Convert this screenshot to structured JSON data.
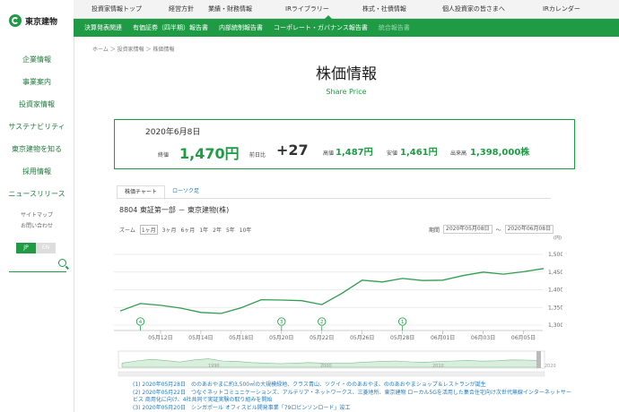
{
  "brand": {
    "name": "東京建物"
  },
  "sidebar": {
    "items": [
      {
        "label": "企業情報"
      },
      {
        "label": "事業案内"
      },
      {
        "label": "投資家情報"
      },
      {
        "label": "サステナビリティ"
      },
      {
        "label": "東京建物を知る"
      },
      {
        "label": "採用情報"
      },
      {
        "label": "ニュースリリース"
      }
    ],
    "small": [
      "サイトマップ",
      "お問い合わせ"
    ],
    "lang": {
      "jp": "JP",
      "en": "EN"
    }
  },
  "topnav": [
    "投資家情報トップ",
    "経営方針",
    "業績・財務情報",
    "IRライブラリー",
    "株式・社債情報",
    "個人投資家の皆さまへ",
    "IRカレンダー"
  ],
  "subnav": [
    {
      "label": "決算発表関連",
      "dim": false
    },
    {
      "label": "有価証券（四半期）報告書",
      "dim": false
    },
    {
      "label": "内部統制報告書",
      "dim": false
    },
    {
      "label": "コーポレート・ガバナンス報告書",
      "dim": false
    },
    {
      "label": "統合報告書",
      "dim": true
    }
  ],
  "breadcrumb": "ホーム ＞ 投資家情報 ＞ 株価情報",
  "page": {
    "title": "株価情報",
    "subtitle": "Share Price"
  },
  "price": {
    "date": "2020年6月8日",
    "end_label": "終値",
    "end_value": "1,470円",
    "change_label": "前日比",
    "change_value": "+27",
    "high_label": "高値",
    "high_value": "1,487円",
    "low_label": "安値",
    "low_value": "1,461円",
    "volume_label": "出来高",
    "volume_value": "1,398,000株"
  },
  "tabs": [
    {
      "label": "株価チャート",
      "active": true
    },
    {
      "label": "ローソク足",
      "active": false
    }
  ],
  "stock_name": "8804 東証第一部 － 東京建物(株)",
  "zoom": {
    "label": "ズーム",
    "options": [
      "1ヶ月",
      "3ヶ月",
      "6ヶ月",
      "1年",
      "2年",
      "5年",
      "10年"
    ],
    "selected": "1ヶ月"
  },
  "range": {
    "label": "期間",
    "from": "2020年05月08日",
    "sep": "～",
    "to": "2020年06月08日"
  },
  "chart_data": {
    "type": "line",
    "unit": "(円)",
    "yticks": [
      1300,
      1350,
      1400,
      1450,
      1500
    ],
    "ytick_labels": [
      "1,300",
      "1,350",
      "1,400",
      "1,450",
      "1,500"
    ],
    "ylim": [
      1300,
      1500
    ],
    "xticks": [
      "05月12日",
      "05月14日",
      "05月18日",
      "05月20日",
      "05月22日",
      "05月26日",
      "05月28日",
      "06月01日",
      "06月03日",
      "06月05日"
    ],
    "xtick_index": [
      2,
      4,
      6,
      8,
      10,
      12,
      14,
      16,
      18,
      20
    ],
    "values": [
      1340,
      1361,
      1356,
      1348,
      1336,
      1333,
      1349,
      1372,
      1371,
      1369,
      1358,
      1390,
      1427,
      1422,
      1432,
      1426,
      1427,
      1440,
      1450,
      1444,
      1451,
      1460
    ],
    "events": [
      {
        "label": "4",
        "index": 1
      },
      {
        "label": "3",
        "index": 8
      },
      {
        "label": "2",
        "index": 10
      },
      {
        "label": "1",
        "index": 14
      }
    ],
    "navigator": {
      "labels": [
        "1990",
        "2000",
        "2010",
        "2020"
      ],
      "values": [
        0.3,
        0.5,
        0.65,
        0.55,
        0.4,
        0.6,
        0.7,
        0.5,
        0.45,
        0.35,
        0.3,
        0.25,
        0.3,
        0.35,
        0.3,
        0.28,
        0.32,
        0.4,
        0.45,
        0.5,
        0.42,
        0.38,
        0.44,
        0.5,
        0.55,
        0.48,
        0.52,
        0.6,
        0.58,
        0.55
      ]
    }
  },
  "news": [
    "(1) 2020年05月28日　ののあおやまに約3,500㎡の大規模緑地、クラス青山、ツクイ・ののあおやま、ののあおやまショップ＆レストランが誕生",
    "(2) 2020年05月22日　つなぐネットコミュニケーションズ、アルテリア・ネットワークス、三菱地所、東京建物 ローカル5Gを活用した集合住宅向け次世代無線インターネットサービス 商用化に向け、4社共同で実証実験の取り組みを開始",
    "(3) 2020年05月20日　シンガポール オフィスビル開発事業「79ロビンソンロード」竣工"
  ]
}
